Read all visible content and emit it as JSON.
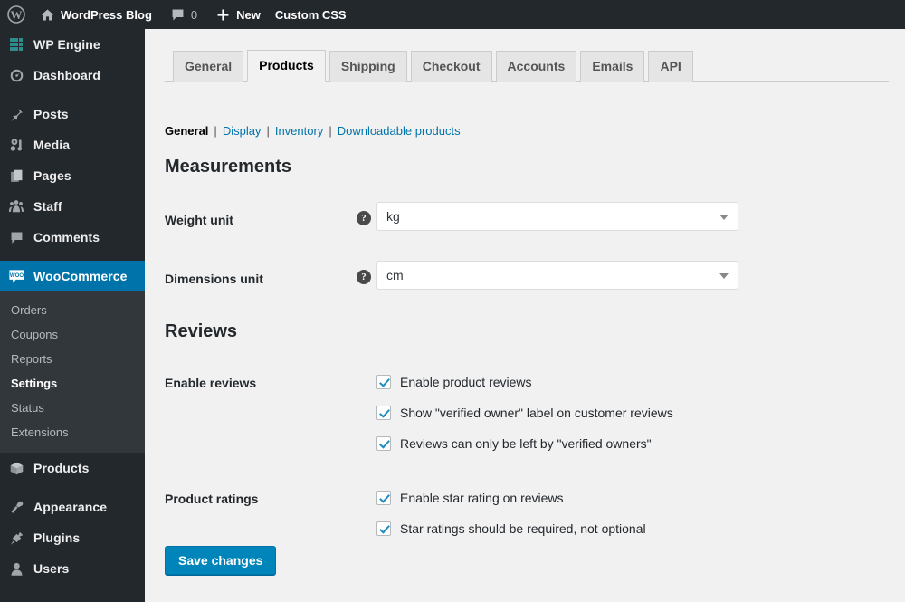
{
  "adminbar": {
    "wp_logo_icon": "wordpress-logo-icon",
    "site_home_icon": "home-icon",
    "site_name": "WordPress Blog",
    "comments_icon": "comment-bubble-icon",
    "comments_count": "0",
    "new_icon": "plus-icon",
    "new_label": "New",
    "custom_css_label": "Custom CSS"
  },
  "sidebar": {
    "items": [
      {
        "label": "WP Engine",
        "icon": "grid-squares-icon",
        "current": false
      },
      {
        "label": "Dashboard",
        "icon": "gauge-icon",
        "current": false
      },
      {
        "label": "Posts",
        "icon": "pushpin-icon",
        "current": false
      },
      {
        "label": "Media",
        "icon": "media-icon",
        "current": false
      },
      {
        "label": "Pages",
        "icon": "pages-icon",
        "current": false
      },
      {
        "label": "Staff",
        "icon": "group-icon",
        "current": false
      },
      {
        "label": "Comments",
        "icon": "comment-bubble-icon",
        "current": false
      },
      {
        "label": "WooCommerce",
        "icon": "woocommerce-logo-icon",
        "current": true
      },
      {
        "label": "Products",
        "icon": "box-icon",
        "current": false
      },
      {
        "label": "Appearance",
        "icon": "paintbrush-icon",
        "current": false
      },
      {
        "label": "Plugins",
        "icon": "plug-icon",
        "current": false
      },
      {
        "label": "Users",
        "icon": "user-icon",
        "current": false
      }
    ],
    "submenu": [
      {
        "label": "Orders",
        "current": false
      },
      {
        "label": "Coupons",
        "current": false
      },
      {
        "label": "Reports",
        "current": false
      },
      {
        "label": "Settings",
        "current": true
      },
      {
        "label": "Status",
        "current": false
      },
      {
        "label": "Extensions",
        "current": false
      }
    ]
  },
  "tabs": [
    {
      "label": "General",
      "active": false
    },
    {
      "label": "Products",
      "active": true
    },
    {
      "label": "Shipping",
      "active": false
    },
    {
      "label": "Checkout",
      "active": false
    },
    {
      "label": "Accounts",
      "active": false
    },
    {
      "label": "Emails",
      "active": false
    },
    {
      "label": "API",
      "active": false
    }
  ],
  "subtabs": [
    {
      "label": "General",
      "current": true
    },
    {
      "label": "Display",
      "current": false
    },
    {
      "label": "Inventory",
      "current": false
    },
    {
      "label": "Downloadable products",
      "current": false
    }
  ],
  "subtab_separator": "|",
  "sections": {
    "measurements": {
      "title": "Measurements",
      "fields": [
        {
          "label": "Weight unit",
          "value": "kg",
          "help": "?",
          "help_icon": "help-circle-icon"
        },
        {
          "label": "Dimensions unit",
          "value": "cm",
          "help": "?",
          "help_icon": "help-circle-icon"
        }
      ]
    },
    "reviews": {
      "title": "Reviews",
      "groups": [
        {
          "label": "Enable reviews",
          "options": [
            {
              "text": "Enable product reviews",
              "checked": true
            },
            {
              "text": "Show \"verified owner\" label on customer reviews",
              "checked": true
            },
            {
              "text": "Reviews can only be left by \"verified owners\"",
              "checked": true
            }
          ]
        },
        {
          "label": "Product ratings",
          "options": [
            {
              "text": "Enable star rating on reviews",
              "checked": true
            },
            {
              "text": "Star ratings should be required, not optional",
              "checked": true
            }
          ]
        }
      ]
    }
  },
  "save_button": {
    "label": "Save changes"
  },
  "colors": {
    "adminbar_bg": "#23282d",
    "sidebar_bg": "#23282d",
    "submenu_bg": "#32373c",
    "current_menu_bg": "#0073aa",
    "content_bg": "#f1f1f1",
    "link": "#0073aa",
    "button_primary": "#0085ba",
    "checkmark": "#1e8cbe",
    "wpengine_icon": "#2e8c8c"
  }
}
